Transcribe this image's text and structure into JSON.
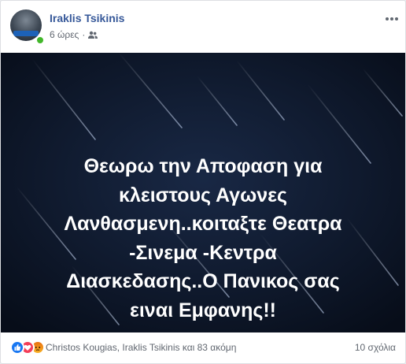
{
  "post": {
    "author": "Iraklis Tsikinis",
    "time": "6 ώρες",
    "separator": "·",
    "audience_icon": "friends-icon",
    "image_text": "Θεωρω την Αποφαση για\nκλειστους Αγωνες\nΛανθασμενη..κοιταξτε Θεατρα\n-Σινεμα -Κεντρα\nΔιασκεδασης..Ο Πανικος σας\nειναι Εμφανης!!"
  },
  "reactions": {
    "types": [
      "like",
      "love",
      "angry"
    ],
    "names": "Christos Kougias, Iraklis Tsikinis και 83 ακόμη"
  },
  "comments": {
    "label": "10 σχόλια"
  },
  "colors": {
    "author_link": "#365899",
    "meta_text": "#616770",
    "image_background": "#0d1526",
    "online": "#42b72a",
    "like": "#1877f2",
    "love": "#f33e58",
    "angry": "#e9710f"
  }
}
